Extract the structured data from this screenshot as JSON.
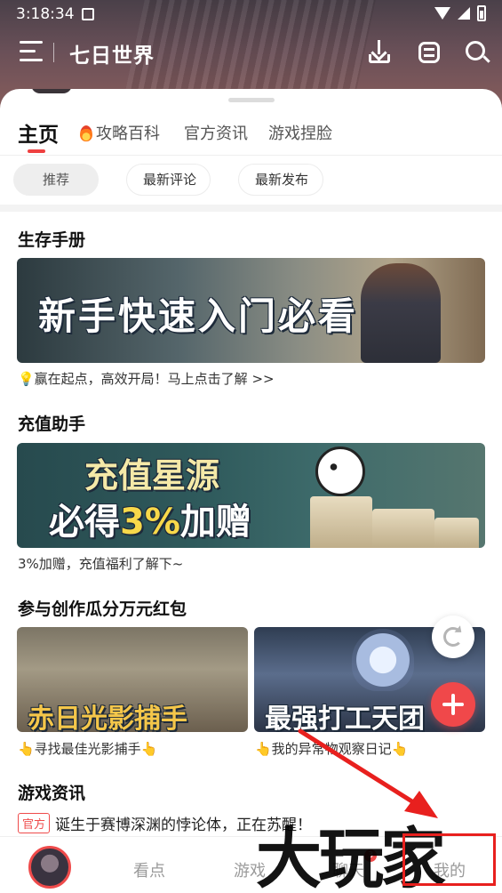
{
  "status_bar": {
    "time": "3:18:34"
  },
  "header": {
    "title": "七日世界"
  },
  "tabs": [
    {
      "label": "主页"
    },
    {
      "label": "攻略百科"
    },
    {
      "label": "官方资讯"
    },
    {
      "label": "游戏捏脸"
    }
  ],
  "filters": [
    {
      "label": "推荐"
    },
    {
      "label": "最新评论"
    },
    {
      "label": "最新发布"
    }
  ],
  "sections": {
    "survival": {
      "title": "生存手册",
      "banner_text": "新手快速入门必看",
      "caption": "💡赢在起点，高效开局！马上点击了解 >>"
    },
    "recharge": {
      "title": "充值助手",
      "banner_line1": "充值星源",
      "banner_line2_pre": "必得",
      "banner_line2_pct": "3%",
      "banner_line2_post": "加赠",
      "caption": "3%加赠，充值福利了解下~"
    },
    "creation": {
      "title": "参与创作瓜分万元红包",
      "cards": [
        {
          "banner_text": "赤日光影捕手",
          "caption": "👆寻找最佳光影捕手👆"
        },
        {
          "banner_text": "最强打工天团",
          "caption": "👆我的异常物观察日记👆"
        }
      ]
    },
    "news": {
      "title": "游戏资讯",
      "tag": "官方",
      "headline": "诞生于赛博深渊的悖论体，正在苏醒！"
    }
  },
  "bottom_nav": {
    "items": [
      {
        "label": "看点"
      },
      {
        "label": "游戏"
      },
      {
        "label": "聊天",
        "badge": "3"
      },
      {
        "label": "我的"
      }
    ]
  },
  "watermark": "大玩家",
  "colors": {
    "accent": "#ef4b4b",
    "annotation": "#e8201e"
  }
}
